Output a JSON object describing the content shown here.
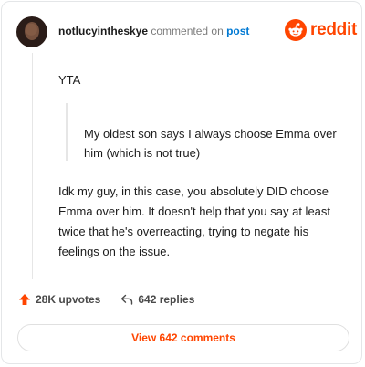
{
  "comment": {
    "username": "notlucyintheskye",
    "action_text": " commented on ",
    "post_link": "post",
    "verdict": "YTA",
    "quote": "My oldest son says I always choose Emma over him (which is not true)",
    "body": "Idk my guy, in this case, you absolutely DID choose Emma over him. It doesn't help that you say at least twice that he's overreacting, trying to negate his feelings on the issue."
  },
  "brand": {
    "name": "reddit",
    "color": "#ff4500",
    "icon": "reddit-snoo-icon"
  },
  "stats": {
    "upvotes": "28K upvotes",
    "upvote_icon": "upvote-arrow-icon",
    "replies": "642 replies",
    "reply_icon": "reply-arrow-icon"
  },
  "actions": {
    "view_comments_label": "View 642 comments"
  },
  "colors": {
    "link": "#0079d3",
    "accent": "#ff4500",
    "muted": "#7c7c7c"
  }
}
